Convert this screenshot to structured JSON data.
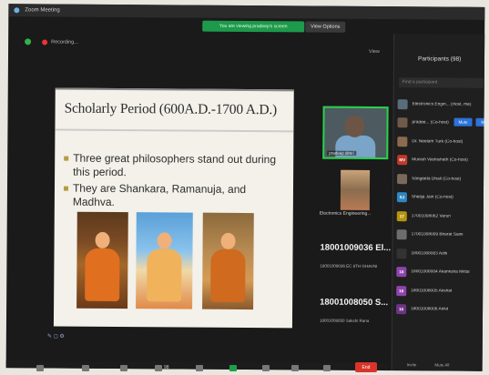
{
  "window": {
    "title": "Zoom Meeting"
  },
  "share_banner": "You are viewing pradeep's screen",
  "view_options": "View Options",
  "recording": "Recording...",
  "view": "View",
  "slide": {
    "title": "Scholarly Period (600A.D.-1700 A.D.)",
    "bullets": [
      "Three great philosophers stand out during this period.",
      "They are Shankara, Ramanuja, and Madhva."
    ]
  },
  "tiles": {
    "cam_caption": "pradeep dimri",
    "room_caption": "Electronics Engineering...",
    "tile1_name": "18001009036 El...",
    "tile1_sub": "18001009036 EC 8TH GHAVNI",
    "tile2_name": "18001008050 S...",
    "tile2_sub": "18001008050 Sakshi Rana"
  },
  "participants": {
    "title": "Participants (98)",
    "search_placeholder": "Find a participant",
    "mute_label": "Mute",
    "more_label": "More",
    "rows": [
      {
        "name": "Electronics Engin... (Host, me)",
        "initials": "",
        "color": "#5a6b7a"
      },
      {
        "name": "pradee... (Co-host)",
        "initials": "",
        "color": "#6f5a4a"
      },
      {
        "name": "Dr. Neelam Turk (Co-host)",
        "initials": "",
        "color": "#8a6b4f"
      },
      {
        "name": "Munish Vashishath (Co-host)",
        "initials": "MV",
        "color": "#c0392b"
      },
      {
        "name": "Sangeeta Dhall (Co-host)",
        "initials": "",
        "color": "#7a6a5a"
      },
      {
        "name": "Sheilja Jain (Co-host)",
        "initials": "SJ",
        "color": "#2e86c1"
      },
      {
        "name": "17001008062 Varun",
        "initials": "17",
        "color": "#b7950b"
      },
      {
        "name": "17001008009 Bharat Saini",
        "initials": "",
        "color": "#6d6d6d"
      },
      {
        "name": "18001008003 Aditi",
        "initials": "",
        "color": "#333333"
      },
      {
        "name": "18001008004 Akanksha Mittal",
        "initials": "18",
        "color": "#8e44ad"
      },
      {
        "name": "18001008005 Akshat",
        "initials": "18",
        "color": "#8e44ad"
      },
      {
        "name": "18001008006 Ankit",
        "initials": "18",
        "color": "#6c3483"
      }
    ],
    "footer_invite": "Invite",
    "footer_mute_all": "Mute All"
  },
  "toolbar": {
    "participant_count": "98",
    "end_label": "End"
  }
}
